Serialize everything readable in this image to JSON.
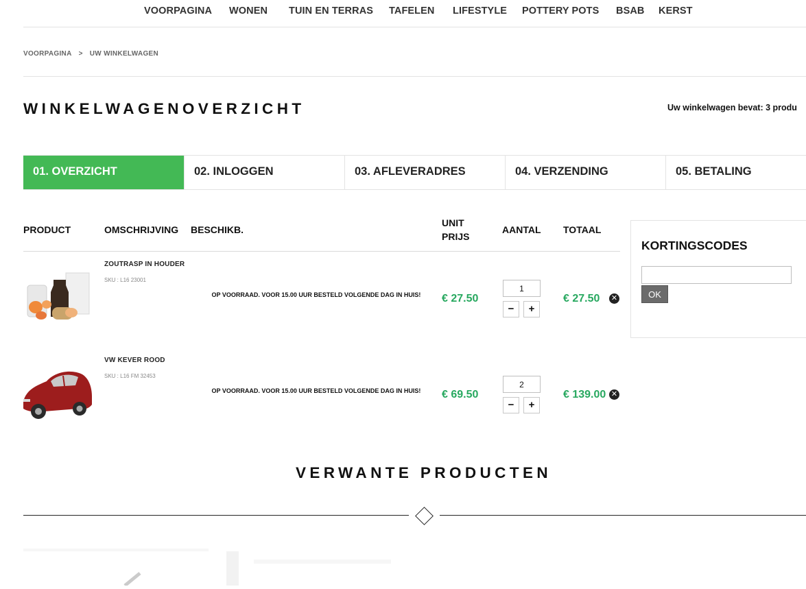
{
  "nav": {
    "items": [
      {
        "label": "VOORPAGINA"
      },
      {
        "label": "WONEN"
      },
      {
        "label": "TUIN EN TERRAS"
      },
      {
        "label": "TAFELEN"
      },
      {
        "label": "LIFESTYLE"
      },
      {
        "label": "POTTERY POTS"
      },
      {
        "label": "BSAB"
      },
      {
        "label": "KERST"
      }
    ]
  },
  "breadcrumb": {
    "home": "VOORPAGINA",
    "separator": ">",
    "current": "UW WINKELWAGEN"
  },
  "page": {
    "title": "WINKELWAGENOVERZICHT",
    "cart_count_text": "Uw winkelwagen bevat: 3 produ"
  },
  "steps": [
    {
      "label": "01. OVERZICHT",
      "active": true
    },
    {
      "label": "02. INLOGGEN",
      "active": false
    },
    {
      "label": "03. AFLEVERADRES",
      "active": false
    },
    {
      "label": "04. VERZENDING",
      "active": false
    },
    {
      "label": "05. BETALING",
      "active": false
    }
  ],
  "table": {
    "headers": {
      "product": "PRODUCT",
      "description": "OMSCHRIJVING",
      "availability": "BESCHIKB.",
      "unit_price_1": "UNIT",
      "unit_price_2": "PRIJS",
      "quantity": "AANTAL",
      "total": "TOTAAL"
    },
    "rows": [
      {
        "name": "ZOUTRASP IN HOUDER",
        "sku": "SKU : L16 23001",
        "availability": "OP VOORRAAD. VOOR 15.00 UUR BESTELD VOLGENDE DAG IN HUIS!",
        "unit_price": "€ 27.50",
        "quantity": "1",
        "total": "€ 27.50",
        "minus": "−",
        "plus": "+",
        "remove": "✕"
      },
      {
        "name": "VW KEVER ROOD",
        "sku": "SKU : L16 FM 32453",
        "availability": "OP VOORRAAD. VOOR 15.00 UUR BESTELD VOLGENDE DAG IN HUIS!",
        "unit_price": "€ 69.50",
        "quantity": "2",
        "total": "€ 139.00",
        "minus": "−",
        "plus": "+",
        "remove": "✕"
      }
    ]
  },
  "coupon": {
    "title": "KORTINGSCODES",
    "input_value": "",
    "ok_label": "OK"
  },
  "related": {
    "title": "VERWANTE PRODUCTEN"
  },
  "colors": {
    "accent": "#43b955",
    "price": "#27a85f"
  }
}
